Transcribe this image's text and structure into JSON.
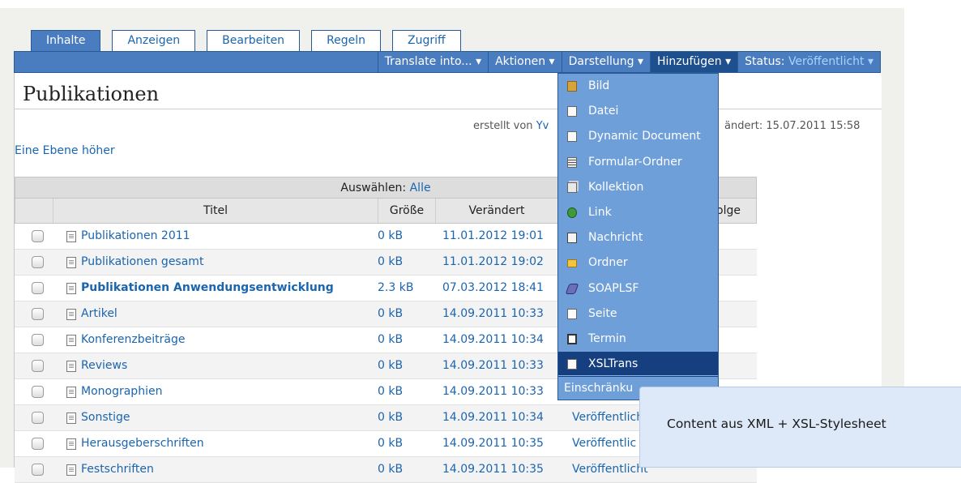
{
  "tabs": [
    {
      "label": "Inhalte",
      "active": true
    },
    {
      "label": "Anzeigen",
      "active": false
    },
    {
      "label": "Bearbeiten",
      "active": false
    },
    {
      "label": "Regeln",
      "active": false
    },
    {
      "label": "Zugriff",
      "active": false
    }
  ],
  "actionbar": {
    "translate": "Translate into... ▾",
    "aktionen": "Aktionen ▾",
    "darstellung": "Darstellung ▾",
    "hinzufuegen": "Hinzufügen ▾",
    "status_label": "Status:",
    "status_value": "Veröffentlicht ▾"
  },
  "page": {
    "title": "Publikationen",
    "created_by_prefix": "erstellt von",
    "created_by_user": "Yv",
    "changed": "ändert: 15.07.2011 15:58",
    "up_link": "Eine Ebene höher"
  },
  "table": {
    "select_label": "Auswählen:",
    "select_all": "Alle",
    "headers": {
      "title": "Titel",
      "size": "Größe",
      "changed": "Verändert",
      "order": "olge"
    },
    "rows": [
      {
        "title": "Publikationen 2011",
        "size": "0 kB",
        "date": "11.01.2012 19:01",
        "status": "",
        "bold": false
      },
      {
        "title": "Publikationen gesamt",
        "size": "0 kB",
        "date": "11.01.2012 19:02",
        "status": "",
        "bold": false
      },
      {
        "title": "Publikationen Anwendungsentwicklung",
        "size": "2.3 kB",
        "date": "07.03.2012 18:41",
        "status": "",
        "bold": true
      },
      {
        "title": "Artikel",
        "size": "0 kB",
        "date": "14.09.2011 10:33",
        "status": "",
        "bold": false
      },
      {
        "title": "Konferenzbeiträge",
        "size": "0 kB",
        "date": "14.09.2011 10:34",
        "status": "",
        "bold": false
      },
      {
        "title": "Reviews",
        "size": "0 kB",
        "date": "14.09.2011 10:33",
        "status": "",
        "bold": false
      },
      {
        "title": "Monographien",
        "size": "0 kB",
        "date": "14.09.2011 10:33",
        "status": "",
        "bold": false
      },
      {
        "title": "Sonstige",
        "size": "0 kB",
        "date": "14.09.2011 10:34",
        "status": "Veröffentlich",
        "bold": false
      },
      {
        "title": "Herausgeberschriften",
        "size": "0 kB",
        "date": "14.09.2011 10:35",
        "status": "Veröffentlic",
        "bold": false
      },
      {
        "title": "Festschriften",
        "size": "0 kB",
        "date": "14.09.2011 10:35",
        "status": "Veröffentlicht",
        "bold": false
      }
    ]
  },
  "dropdown": {
    "items": [
      {
        "label": "Bild",
        "icon": "image-icon"
      },
      {
        "label": "Datei",
        "icon": "file-icon"
      },
      {
        "label": "Dynamic Document",
        "icon": "document-icon"
      },
      {
        "label": "Formular-Ordner",
        "icon": "form-folder-icon"
      },
      {
        "label": "Kollektion",
        "icon": "collection-icon"
      },
      {
        "label": "Link",
        "icon": "link-icon"
      },
      {
        "label": "Nachricht",
        "icon": "news-icon"
      },
      {
        "label": "Ordner",
        "icon": "folder-icon"
      },
      {
        "label": "SOAPLSF",
        "icon": "soap-icon"
      },
      {
        "label": "Seite",
        "icon": "page-icon"
      },
      {
        "label": "Termin",
        "icon": "event-icon"
      },
      {
        "label": "XSLTrans",
        "icon": "xsl-icon",
        "highlighted": true
      }
    ],
    "footer": "Einschränku"
  },
  "tooltip": {
    "text": "Content aus XML + XSL-Stylesheet"
  },
  "colors": {
    "accent": "#4a7cc0",
    "menu_bg": "#6f9fd9",
    "menu_highlight": "#163f80",
    "link": "#1a65b0"
  }
}
